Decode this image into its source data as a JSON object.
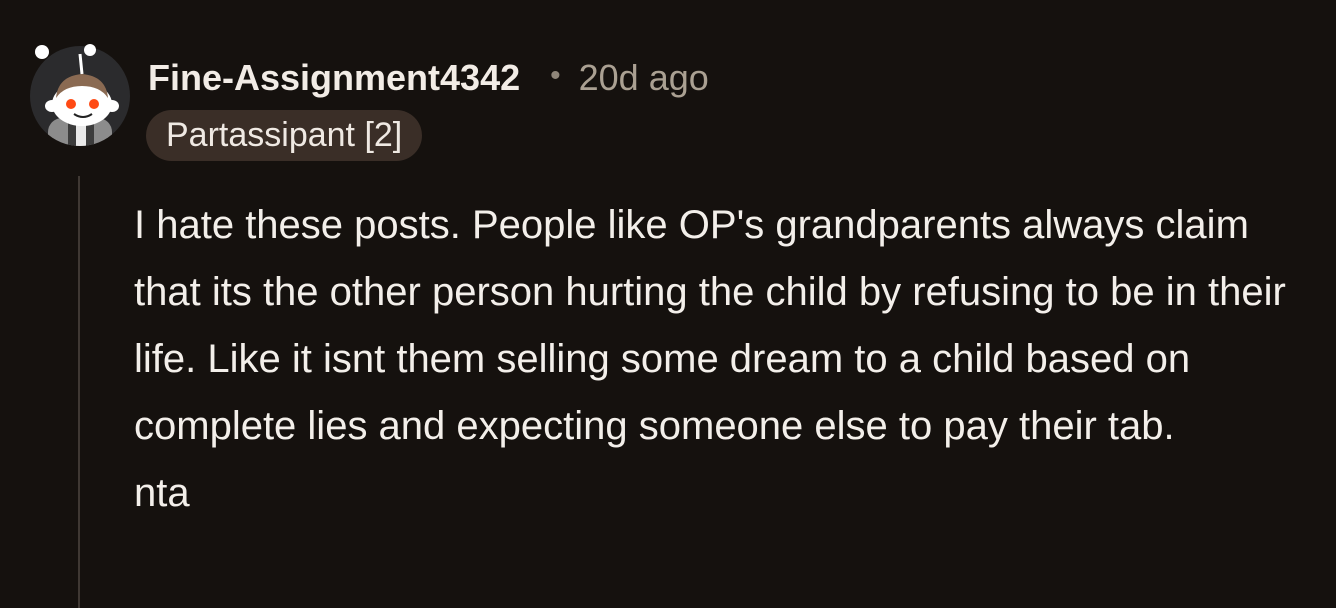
{
  "comment": {
    "author": "Fine-Assignment4342",
    "separator": "•",
    "timestamp": "20d ago",
    "flair": "Partassipant [2]",
    "avatar_icon": "snoo-avatar-icon",
    "body": [
      "I hate these posts. People like OP's grandparents always claim that its the other person hurting the child by refusing to be in their life. Like it isnt them selling some dream to a child based on complete lies and expecting someone else to pay their tab.",
      "nta"
    ]
  },
  "colors": {
    "background": "#15110e",
    "username": "#f2ece6",
    "timestamp": "#aaa092",
    "flair_bg": "#3a2e27",
    "body_text": "#f3efea",
    "thread_line": "#3f3833"
  }
}
